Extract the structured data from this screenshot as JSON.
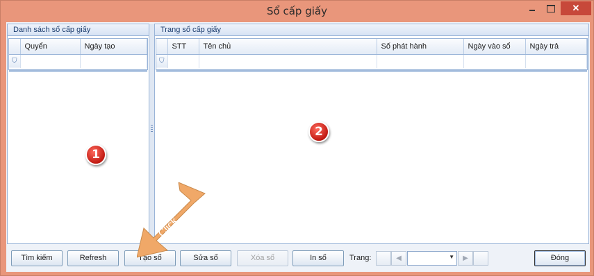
{
  "window": {
    "title": "Sổ cấp giấy",
    "close_glyph": "✕"
  },
  "left_panel": {
    "caption": "Danh sách sổ cấp giấy",
    "columns": [
      "Quyển",
      "Ngày tạo"
    ],
    "badge": "1"
  },
  "right_panel": {
    "caption": "Trang sổ cấp giấy",
    "columns": [
      "STT",
      "Tên chủ",
      "Số phát hành",
      "Ngày vào sổ",
      "Ngày trả"
    ],
    "badge": "2"
  },
  "filter_icon": "funnel-icon",
  "annotation": {
    "arrow_text": "Click",
    "arrow_color": "#f0a868"
  },
  "toolbar": {
    "search": "Tìm kiếm",
    "refresh": "Refresh",
    "create": "Tạo sổ",
    "edit": "Sửa sổ",
    "delete": "Xóa sổ",
    "print": "In sổ",
    "page_label": "Trang:",
    "close": "Đóng"
  },
  "colors": {
    "titlebar": "#e9967b",
    "close_button": "#c7483a",
    "panel_border": "#99b4d8",
    "badge": "#c11a12"
  }
}
